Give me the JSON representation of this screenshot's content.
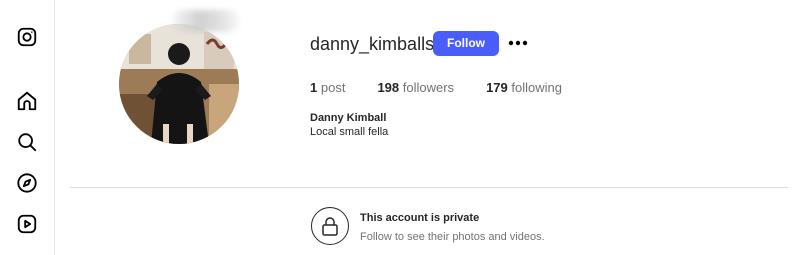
{
  "sidebar": {
    "items": [
      {
        "icon": "instagram-icon"
      },
      {
        "icon": "home-icon"
      },
      {
        "icon": "search-icon"
      },
      {
        "icon": "explore-icon"
      },
      {
        "icon": "reels-icon"
      }
    ]
  },
  "profile": {
    "username": "danny_kimballs",
    "follow_label": "Follow",
    "more_icon": "more-options-icon",
    "stats": {
      "posts_count": "1",
      "posts_label": "post",
      "followers_count": "198",
      "followers_label": "followers",
      "following_count": "179",
      "following_label": "following"
    },
    "full_name": "Danny Kimball",
    "bio": "Local small fella"
  },
  "private_notice": {
    "title": "This account is private",
    "subtitle": "Follow to see their photos and videos.",
    "icon": "lock-icon"
  },
  "colors": {
    "accent": "#4a5df9",
    "secondary_text": "#737373",
    "divider": "#dbdbdb"
  }
}
